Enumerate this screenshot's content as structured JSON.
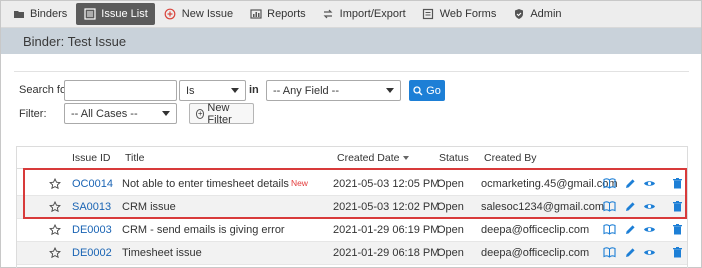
{
  "nav": {
    "items": [
      {
        "label": "Binders",
        "icon": "folder-icon",
        "active": false
      },
      {
        "label": "Issue List",
        "icon": "list-icon",
        "active": true
      },
      {
        "label": "New Issue",
        "icon": "plus-circle-icon",
        "active": false
      },
      {
        "label": "Reports",
        "icon": "report-icon",
        "active": false
      },
      {
        "label": "Import/Export",
        "icon": "swap-icon",
        "active": false
      },
      {
        "label": "Web Forms",
        "icon": "form-icon",
        "active": false
      },
      {
        "label": "Admin",
        "icon": "shield-check-icon",
        "active": false
      }
    ]
  },
  "banner": {
    "title": "Binder: Test Issue"
  },
  "search": {
    "search_label": "Search for:",
    "search_value": "",
    "operator": "Is",
    "in_label": "in",
    "field": "-- Any Field --",
    "go_label": "Go",
    "filter_label": "Filter:",
    "filter_value": "-- All Cases --",
    "new_filter_label": "New Filter"
  },
  "table": {
    "headers": {
      "issue_id": "Issue ID",
      "title": "Title",
      "created_date": "Created Date",
      "status": "Status",
      "created_by": "Created By"
    },
    "rows": [
      {
        "id": "OC0014",
        "title": "Not able to enter timesheet details",
        "badge": "New",
        "date": "2021-05-03 12:05 PM",
        "status": "Open",
        "by": "ocmarketing.45@gmail.com"
      },
      {
        "id": "SA0013",
        "title": "CRM issue",
        "badge": "",
        "date": "2021-05-03 12:02 PM",
        "status": "Open",
        "by": "salesoc1234@gmail.com"
      },
      {
        "id": "DE0003",
        "title": "CRM - send emails is giving error",
        "badge": "",
        "date": "2021-01-29 06:19 PM",
        "status": "Open",
        "by": "deepa@officeclip.com"
      },
      {
        "id": "DE0002",
        "title": "Timesheet issue",
        "badge": "",
        "date": "2021-01-29 06:18 PM",
        "status": "Open",
        "by": "deepa@officeclip.com"
      }
    ]
  },
  "colors": {
    "accent": "#1d7fd6",
    "active_nav": "#5b5b5b",
    "banner": "#c9d2da",
    "highlight": "#d83a3a",
    "id_link": "#1a64b4",
    "badge": "#e33b3b"
  }
}
